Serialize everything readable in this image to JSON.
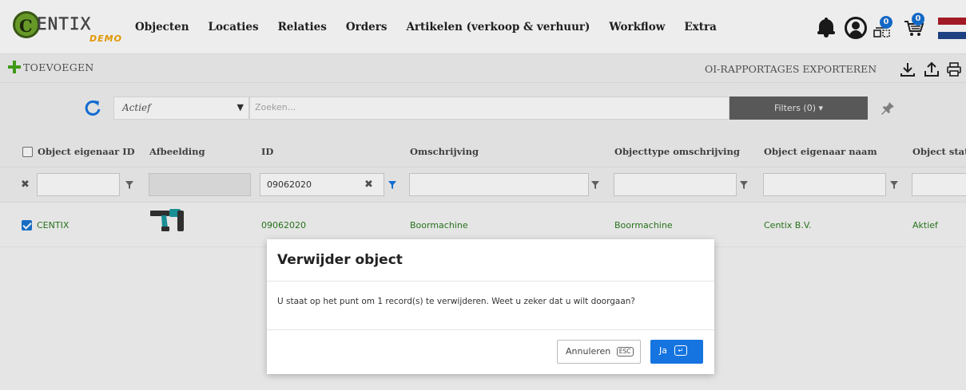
{
  "logo": {
    "word": "ENTIX",
    "letter": "C",
    "sub": "DEMO"
  },
  "nav": [
    "Objecten",
    "Locaties",
    "Relaties",
    "Orders",
    "Artikelen (verkoop & verhuur)",
    "Workflow",
    "Extra"
  ],
  "badges": {
    "downloads": "0",
    "cart": "0"
  },
  "toolbar": {
    "add_label": "TOEVOEGEN",
    "export_label": "OI-RAPPORTAGES EXPORTEREN"
  },
  "filter": {
    "status_value": "Actief",
    "search_placeholder": "Zoeken...",
    "filters_label": "Filters (0) ▾"
  },
  "columns": [
    "Object eigenaar ID",
    "Afbeelding",
    "ID",
    "Omschrijving",
    "Objecttype omschrijving",
    "Object eigenaar naam",
    "Object status"
  ],
  "column_filters": {
    "id": "09062020"
  },
  "rows": [
    {
      "owner_id": "CENTIX",
      "id": "09062020",
      "description": "Boormachine",
      "type_description": "Boormachine",
      "owner_name": "Centix B.V.",
      "status": "Aktief"
    }
  ],
  "dialog": {
    "title": "Verwijder object",
    "message": "U staat op het punt om 1 record(s) te verwijderen. Weet u zeker dat u wilt doorgaan?",
    "cancel_label": "Annuleren",
    "cancel_key": "ESC",
    "confirm_label": "Ja",
    "confirm_key": "↵"
  },
  "colors": {
    "accent": "#1574e0",
    "green_text": "#2a7a1e",
    "add_green": "#45a51a",
    "filters_btn": "#5f5f5f"
  }
}
